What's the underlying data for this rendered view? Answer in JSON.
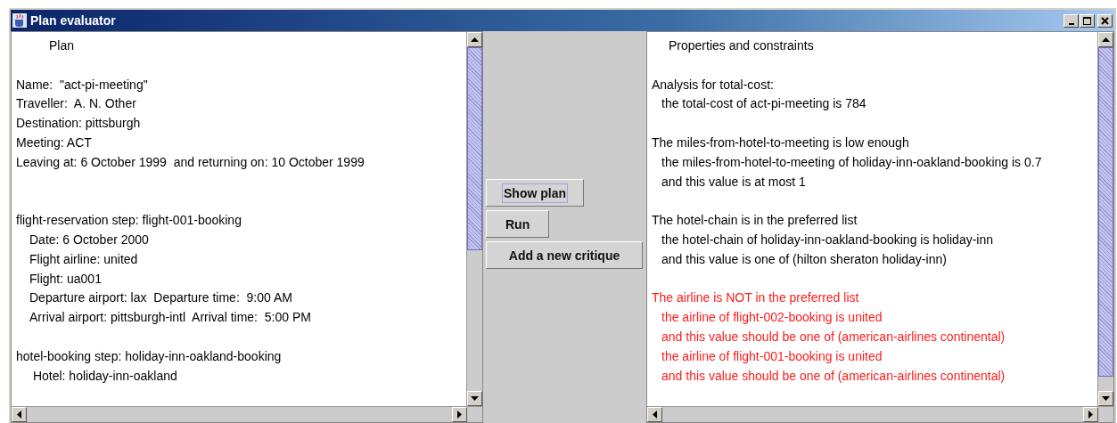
{
  "window": {
    "title": "Plan evaluator"
  },
  "plan_pane": {
    "heading": "Plan",
    "header_lines": [
      "Name:  \"act-pi-meeting\"",
      "Traveller:  A. N. Other",
      "Destination: pittsburgh",
      "Meeting: ACT",
      "Leaving at: 6 October 1999  and returning on: 10 October 1999"
    ],
    "steps": [
      {
        "text": "flight-reservation step: flight-001-booking",
        "children": [
          {
            "text": "Date: 6 October 2000"
          },
          {
            "text": "Flight airline: united"
          },
          {
            "text": "Flight: ua001"
          },
          {
            "text": "Departure airport: lax  Departure time:  9:00 AM"
          },
          {
            "text": "Arrival airport: pittsburgh-intl  Arrival time:  5:00 PM"
          }
        ]
      },
      {
        "text": "hotel-booking step: holiday-inn-oakland-booking",
        "children": [
          {
            "text": " Hotel: holiday-inn-oakland"
          }
        ]
      }
    ]
  },
  "buttons": [
    {
      "label": "Show plan",
      "focused": true
    },
    {
      "label": "Run",
      "focused": false
    },
    {
      "label": "Add a new critique",
      "focused": false
    }
  ],
  "analysis_pane": {
    "heading": "Properties and constraints",
    "results": [
      {
        "text": "Analysis for total-cost:",
        "violated": false,
        "children": [
          {
            "text": "the total-cost of act-pi-meeting is 784"
          }
        ]
      },
      {
        "text": "The miles-from-hotel-to-meeting is low enough",
        "violated": false,
        "children": [
          {
            "text": "the miles-from-hotel-to-meeting of holiday-inn-oakland-booking is 0.7"
          },
          {
            "text": "and this value is at most 1"
          }
        ]
      },
      {
        "text": "The hotel-chain is in the preferred list",
        "violated": false,
        "children": [
          {
            "text": "the hotel-chain of holiday-inn-oakland-booking is holiday-inn"
          },
          {
            "text": "and this value is one of (hilton sheraton holiday-inn)"
          }
        ]
      },
      {
        "text": "The airline is NOT in the preferred list",
        "violated": true,
        "children": [
          {
            "text": "the airline of flight-002-booking is united"
          },
          {
            "text": "and this value should be one of (american-airlines continental)"
          },
          {
            "text": "the airline of flight-001-booking is united"
          },
          {
            "text": "and this value should be one of (american-airlines continental)"
          }
        ]
      }
    ]
  }
}
